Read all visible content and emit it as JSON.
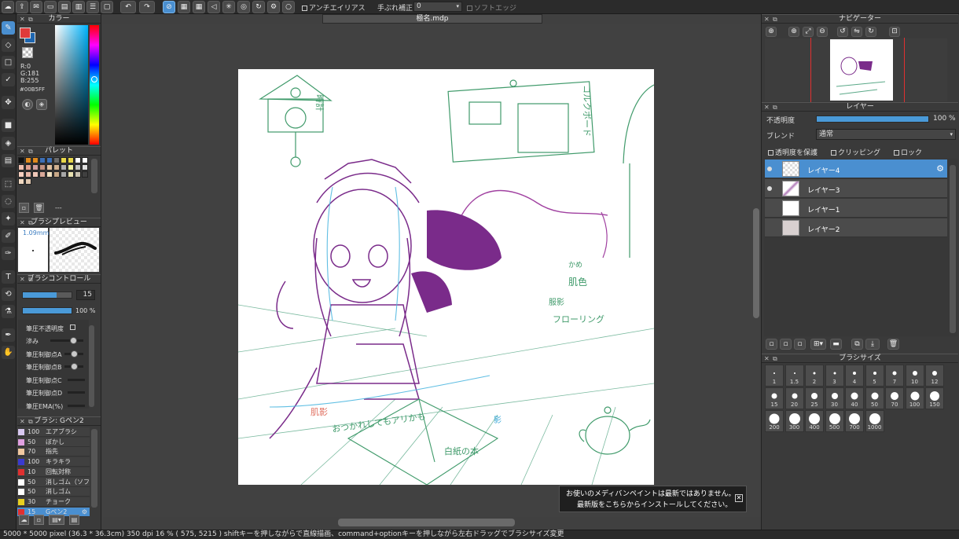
{
  "document_tab": "極名.mdp",
  "topbar": {
    "antialias_label": "アンチエイリアス",
    "stabilizer_label": "手ぶれ補正",
    "stabilizer_value": "0",
    "soft_edge_label": "ソフトエッジ"
  },
  "color_panel": {
    "title": "カラー",
    "r": "R:0",
    "g": "G:181",
    "b": "B:255",
    "hex": "#00B5FF",
    "main_color": "#e03a3a",
    "sub_color": "#1e66b0"
  },
  "palette_panel": {
    "title": "パレット",
    "page_label": "---",
    "swatches": [
      "#111111",
      "#e08a1e",
      "#e08a1e",
      "#3d6fb6",
      "#3d6fb6",
      "#6b6b6b",
      "#e8d84a",
      "#e8d84a",
      "#ffffff",
      "#ffffff",
      "#f0c0b0",
      "#e0a090",
      "#d0a0a0",
      "#c09080",
      "#e0c0a0",
      "#d0b090",
      "#b0b0b0",
      "#f0f0a0",
      "#c0c0c0",
      "#e0e0e0",
      "#f8d0c0",
      "#e8b8a8",
      "#f0c8b8",
      "#d8a898",
      "#f0e0c0",
      "#c8a888",
      "#a8a8a8",
      "#e8e0b0",
      "#c8c0b0",
      "#404040",
      "#f0d8c0",
      "#e0c8b0"
    ]
  },
  "brush_preview": {
    "title": "ブラシプレビュー",
    "size": "1.09mm"
  },
  "brush_control": {
    "title": "ブラシコントロール",
    "size_value": "15",
    "opacity_value": "100 %",
    "size_fill": 0.7,
    "opacity_fill": 1.0,
    "options": [
      "筆圧不透明度",
      "滲み",
      "筆圧制御点A",
      "筆圧制御点B",
      "筆圧制御点C",
      "筆圧制御点D",
      "筆圧EMA(%)"
    ]
  },
  "brush_panel": {
    "title": "ブラシ: Gペン2",
    "items": [
      {
        "size": "100",
        "name": "エアブラシ",
        "color": "#d8c8f0"
      },
      {
        "size": "50",
        "name": "ぼかし",
        "color": "#e0a0e0"
      },
      {
        "size": "70",
        "name": "指先",
        "color": "#f0c8a0"
      },
      {
        "size": "100",
        "name": "キラキラ",
        "color": "#3a3ad0"
      },
      {
        "size": "10",
        "name": "回転対称",
        "color": "#e03030"
      },
      {
        "size": "50",
        "name": "消しゴム（ソフト",
        "color": "#ffffff"
      },
      {
        "size": "50",
        "name": "消しゴム",
        "color": "#ffffff"
      },
      {
        "size": "30",
        "name": "チョーク",
        "color": "#e8d020"
      },
      {
        "size": "15",
        "name": "Gペン2",
        "color": "#e03030",
        "selected": true
      }
    ]
  },
  "navigator": {
    "title": "ナビゲーター"
  },
  "layer_panel": {
    "title": "レイヤー",
    "opacity_label": "不透明度",
    "opacity_value": "100 %",
    "opacity_fill": 1.0,
    "blend_label": "ブレンド",
    "blend_value": "通常",
    "protect_label": "透明度を保護",
    "clipping_label": "クリッピング",
    "lock_label": "ロック",
    "layers": [
      {
        "name": "レイヤー4",
        "selected": true,
        "visible": true
      },
      {
        "name": "レイヤー3",
        "selected": false,
        "visible": true
      },
      {
        "name": "レイヤー1",
        "selected": false,
        "visible": false
      },
      {
        "name": "レイヤー2",
        "selected": false,
        "visible": false
      }
    ]
  },
  "brush_size_panel": {
    "title": "ブラシサイズ",
    "sizes": [
      "1",
      "1.5",
      "2",
      "3",
      "4",
      "5",
      "7",
      "10",
      "12",
      "15",
      "20",
      "25",
      "30",
      "40",
      "50",
      "70",
      "100",
      "150",
      "200",
      "300",
      "400",
      "500",
      "700",
      "1000"
    ]
  },
  "canvas_annotations": {
    "clock": "時計",
    "board": "コルクボード",
    "skin": "肌色",
    "flooring": "フローリング",
    "shadow1": "肌影",
    "shadow2": "影",
    "handwrite": "おつかれしてもアリかも",
    "paper": "白紙の本",
    "extra": "かめ",
    "clothes": "服影"
  },
  "status": {
    "text": "5000 * 5000 pixel   (36.3 * 36.3cm)   350 dpi   16 %   ( 575, 5215 )   shiftキーを押しながらで直線描画、command+optionキーを押しながら左右ドラッグでブラシサイズ変更"
  },
  "notice": {
    "line1": "お使いのメディバンペイントは最新ではありません。",
    "line2": "最新版をこちらからインストールしてください。"
  }
}
